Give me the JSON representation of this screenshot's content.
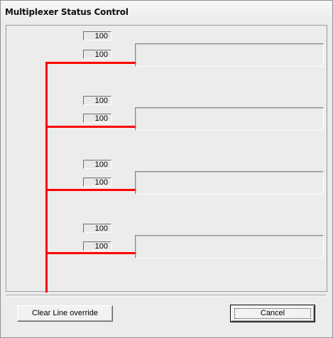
{
  "window": {
    "title": "Multiplexer Status Control"
  },
  "channels": [
    {
      "upper_value": "100",
      "lower_value": "100"
    },
    {
      "upper_value": "100",
      "lower_value": "100"
    },
    {
      "upper_value": "100",
      "lower_value": "100"
    },
    {
      "upper_value": "100",
      "lower_value": "100"
    }
  ],
  "buttons": {
    "clear_line_override": "Clear Line override",
    "cancel": "Cancel"
  },
  "colors": {
    "line": "#ff0000",
    "window_bg": "#ececec"
  }
}
